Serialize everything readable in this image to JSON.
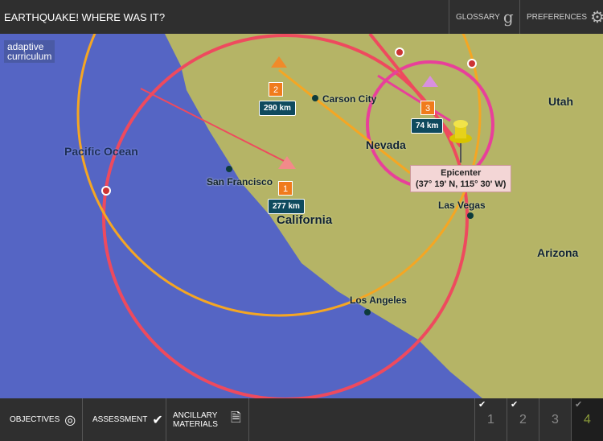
{
  "header": {
    "title": "EARTHQUAKE! WHERE WAS IT?",
    "glossary": "GLOSSARY",
    "preferences": "PREFERENCES"
  },
  "logo": {
    "line1": "adaptive",
    "line2": "curriculum"
  },
  "map": {
    "labels": {
      "ocean": "Pacific Ocean",
      "carson": "Carson City",
      "utah": "Utah",
      "nevada": "Nevada",
      "sf": "San Francisco",
      "california": "California",
      "lasvegas": "Las Vegas",
      "arizona": "Arizona",
      "la": "Los Angeles"
    },
    "stations": [
      {
        "num": "1",
        "distance": "277 km"
      },
      {
        "num": "2",
        "distance": "290 km"
      },
      {
        "num": "3",
        "distance": "74 km"
      }
    ],
    "epicenter": {
      "title": "Epicenter",
      "coords": "(37° 19' N, 115° 30' W)"
    }
  },
  "footer": {
    "objectives": "OBJECTIVES",
    "assessment": "ASSESSMENT",
    "ancillary1": "ANCILLARY",
    "ancillary2": "MATERIALS",
    "pages": [
      {
        "n": "1",
        "done": true
      },
      {
        "n": "2",
        "done": true
      },
      {
        "n": "3",
        "done": false
      },
      {
        "n": "4",
        "done": true,
        "current": true
      }
    ]
  },
  "colors": {
    "circle1": "#ee4a5e",
    "circle2": "#f5a623",
    "circle3": "#e8409a",
    "land": "#b5b466",
    "ocean": "#5565c4"
  }
}
